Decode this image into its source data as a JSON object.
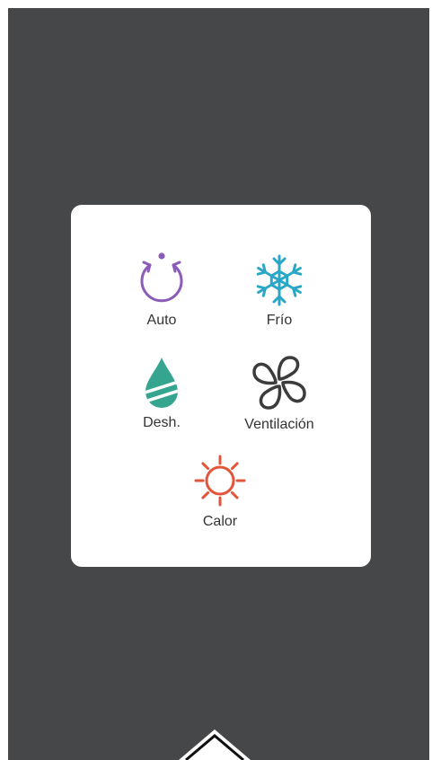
{
  "mode_selector": {
    "options": [
      {
        "label": "Auto",
        "icon": "auto-cycle-icon",
        "color": "#8b5cb8"
      },
      {
        "label": "Frío",
        "icon": "snowflake-icon",
        "color": "#2aa7c4"
      },
      {
        "label": "Desh.",
        "icon": "water-drop-icon",
        "color": "#36a58f"
      },
      {
        "label": "Ventilación",
        "icon": "fan-icon",
        "color": "#3c3c3c"
      },
      {
        "label": "Calor",
        "icon": "sun-icon",
        "color": "#e2553a"
      }
    ]
  },
  "colors": {
    "background": "#464749",
    "popup": "#ffffff",
    "label_text": "#333333"
  }
}
